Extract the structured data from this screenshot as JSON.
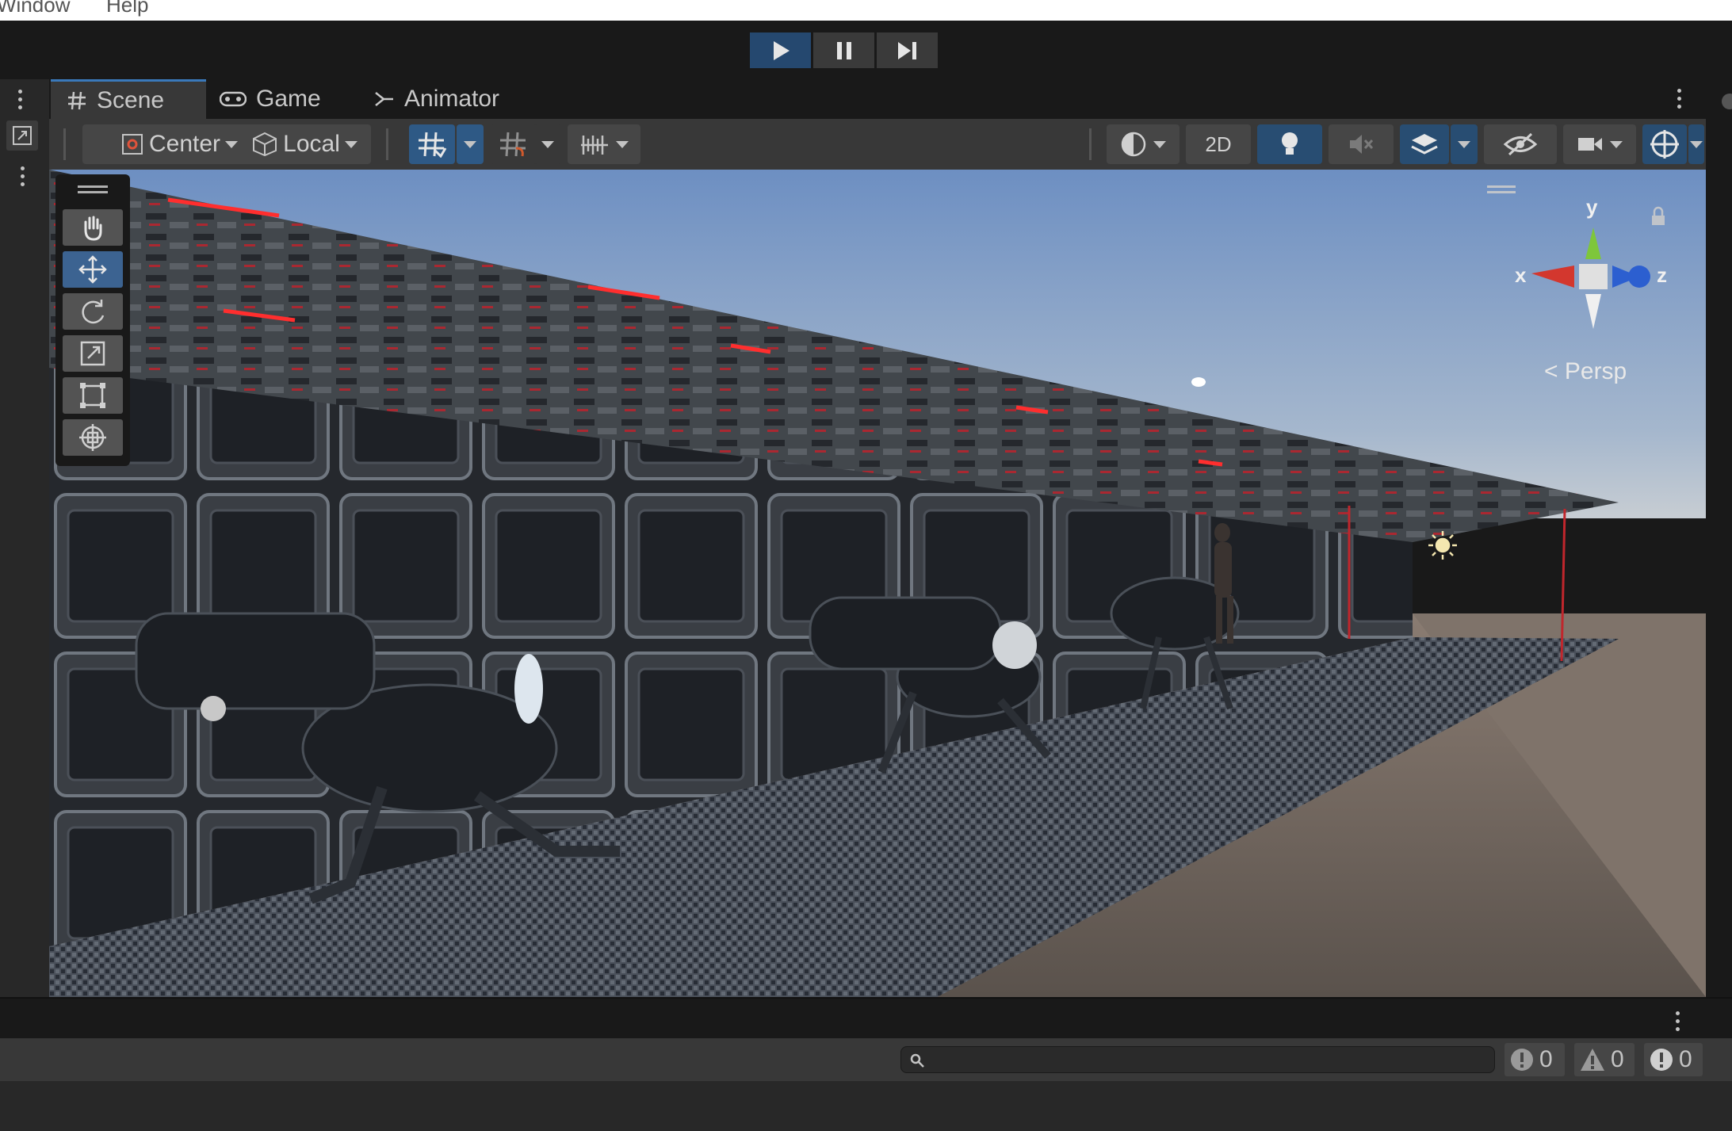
{
  "menu": {
    "items": [
      "Window",
      "Help"
    ]
  },
  "playbar": {
    "play_icon": "play-icon",
    "pause_icon": "pause-icon",
    "step_icon": "step-icon"
  },
  "tabs": [
    {
      "label": "Scene",
      "icon": "hash-icon",
      "active": true
    },
    {
      "label": "Game",
      "icon": "gamepad-icon",
      "active": false
    },
    {
      "label": "Animator",
      "icon": "animator-icon",
      "active": false
    }
  ],
  "toolbar": {
    "pivot_label": "Center",
    "space_label": "Local",
    "mode_2d_label": "2D"
  },
  "tools": [
    "hand-tool",
    "move-tool",
    "rotate-tool",
    "scale-tool",
    "rect-tool",
    "transform-tool"
  ],
  "gizmo": {
    "x_label": "x",
    "y_label": "y",
    "z_label": "z",
    "projection_label": "Persp"
  },
  "console": {
    "search_placeholder": "",
    "error_count": "0",
    "warning_count": "0",
    "info_count": "0"
  },
  "colors": {
    "accent": "#3a79bb",
    "active_button": "#2e5985",
    "panel": "#383838",
    "background": "#191919"
  }
}
